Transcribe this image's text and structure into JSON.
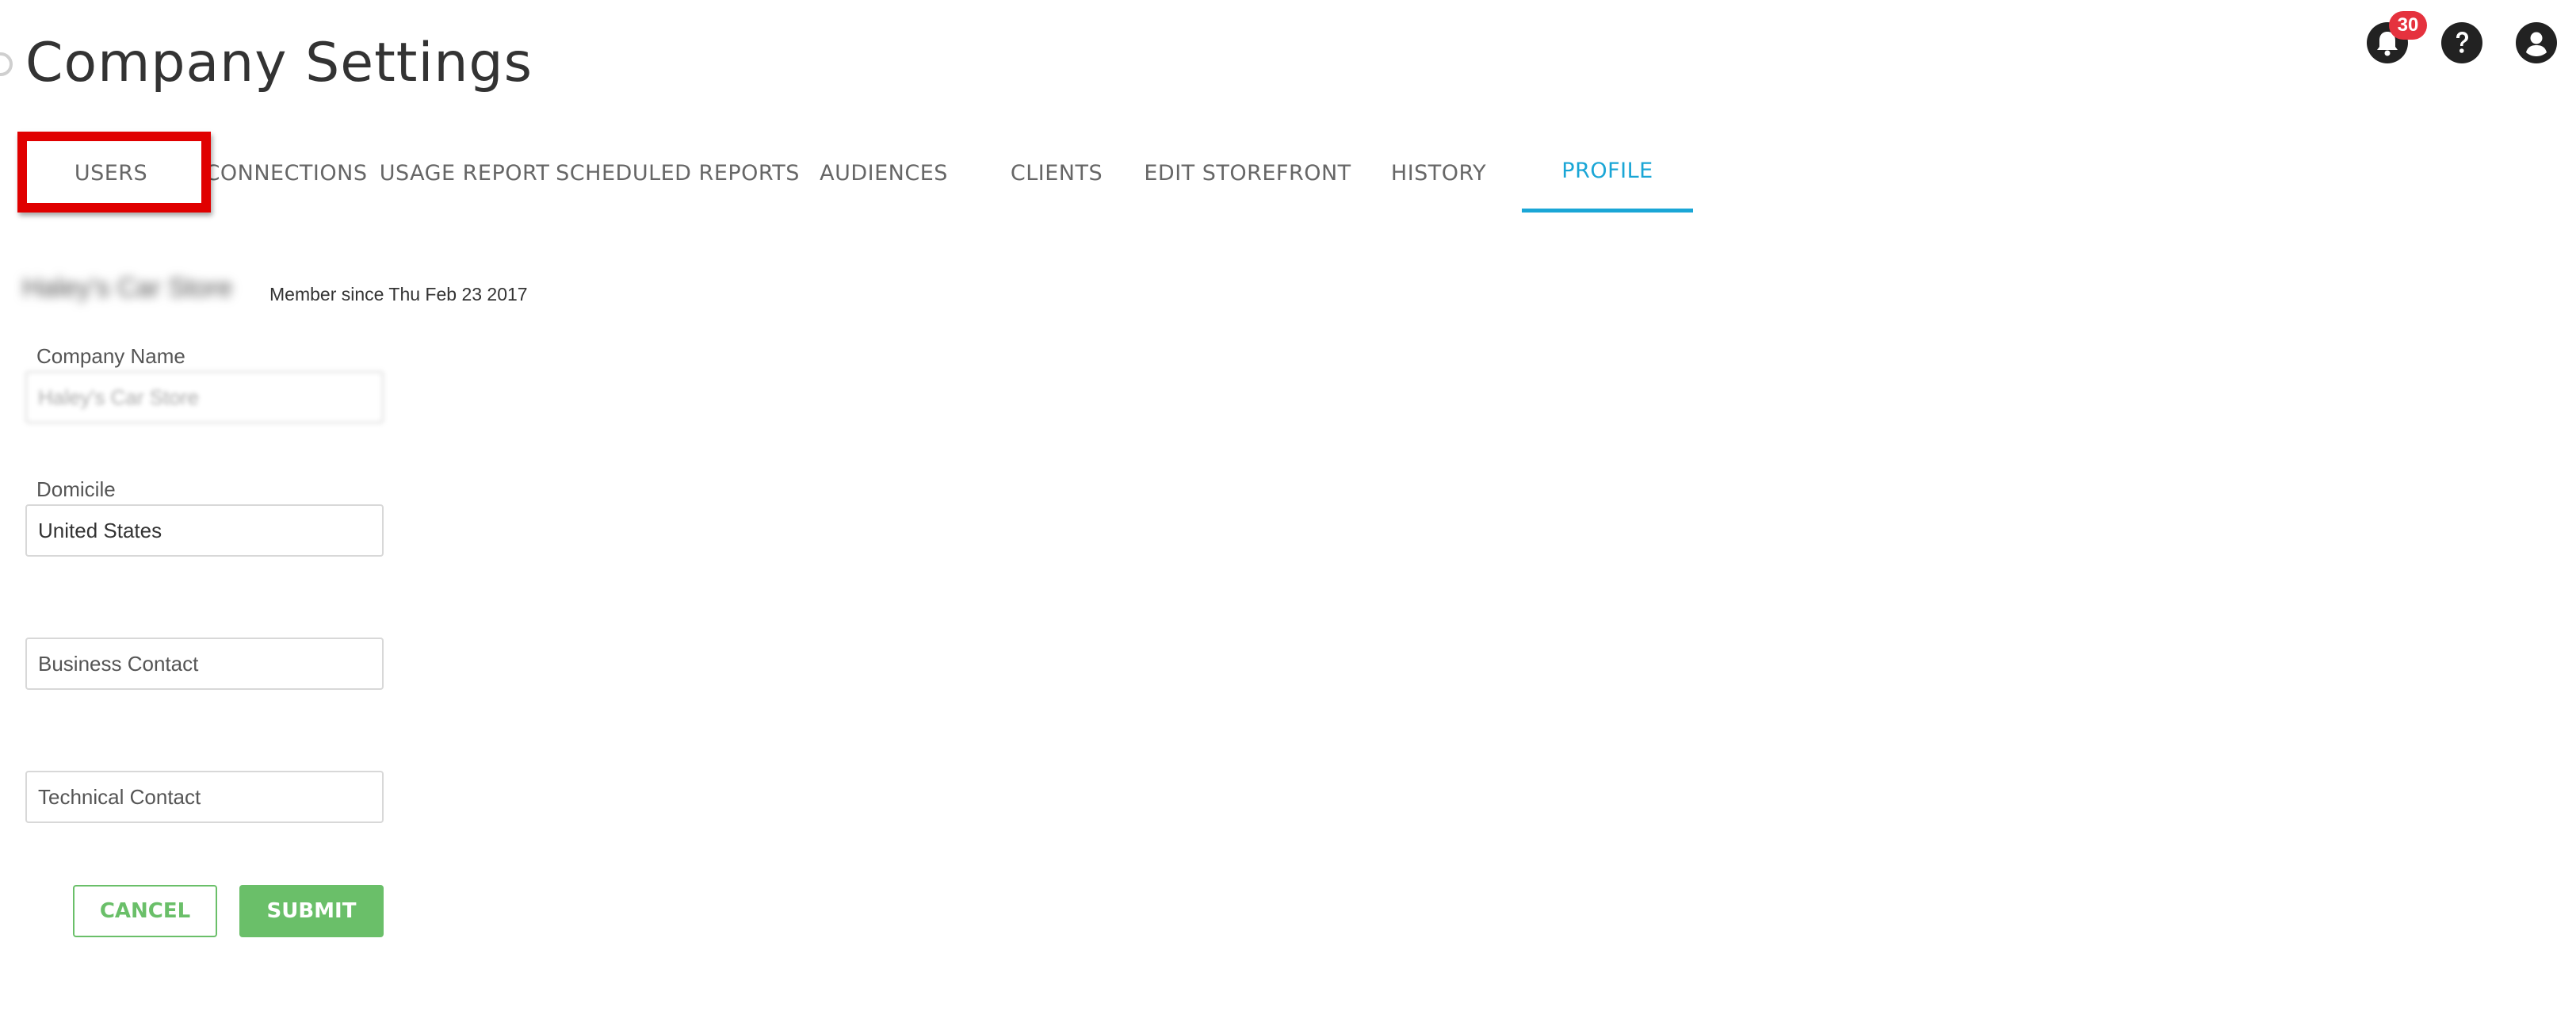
{
  "page": {
    "title": "Company Settings"
  },
  "header": {
    "notifications_count": "30",
    "icons": [
      "bell-icon",
      "help-icon",
      "account-icon"
    ]
  },
  "tabs": [
    {
      "label": "USERS"
    },
    {
      "label": "CONNECTIONS"
    },
    {
      "label": "USAGE REPORT"
    },
    {
      "label": "SCHEDULED REPORTS"
    },
    {
      "label": "AUDIENCES"
    },
    {
      "label": "CLIENTS"
    },
    {
      "label": "EDIT STOREFRONT"
    },
    {
      "label": "HISTORY"
    },
    {
      "label": "PROFILE",
      "active": true
    }
  ],
  "profile": {
    "company_display": "Haley's Car Store",
    "member_since": "Member since Thu Feb 23 2017"
  },
  "form": {
    "company_name_label": "Company Name",
    "company_name_value": "Haley's Car Store",
    "domicile_label": "Domicile",
    "domicile_value": "United States",
    "business_contact_placeholder": "Business Contact",
    "technical_contact_placeholder": "Technical Contact",
    "cancel_label": "CANCEL",
    "submit_label": "SUBMIT"
  },
  "colors": {
    "accent": "#1aa6d6",
    "success": "#6abf69",
    "badge": "#e5323e",
    "highlight": "#e00000"
  }
}
